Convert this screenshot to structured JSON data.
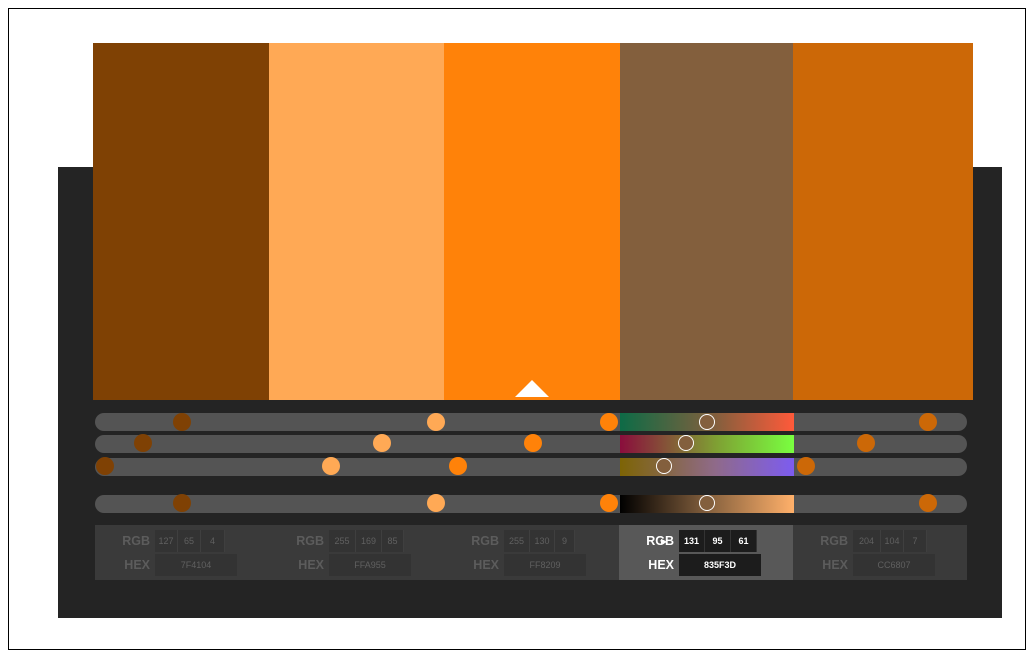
{
  "active_index": 3,
  "swatches": [
    {
      "name": "swatch-1",
      "color": "#7F4104",
      "rgb": [
        "127",
        "65",
        "4"
      ],
      "hex": "7F4104"
    },
    {
      "name": "swatch-2",
      "color": "#FFA955",
      "rgb": [
        "255",
        "169",
        "85"
      ],
      "hex": "FFA955"
    },
    {
      "name": "swatch-3",
      "color": "#FF8209",
      "rgb": [
        "255",
        "130",
        "9"
      ],
      "hex": "FF8209"
    },
    {
      "name": "swatch-4",
      "color": "#835F3D",
      "rgb": [
        "131",
        "95",
        "61"
      ],
      "hex": "835F3D"
    },
    {
      "name": "swatch-5",
      "color": "#CC6807",
      "rgb": [
        "204",
        "104",
        "7"
      ],
      "hex": "CC6807"
    }
  ],
  "labels": {
    "rgb": "RGB",
    "hex": "HEX"
  },
  "pointer_glyph": "▶"
}
